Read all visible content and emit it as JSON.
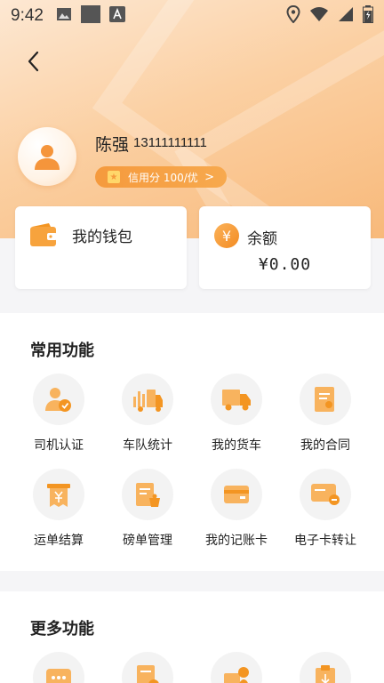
{
  "status_bar": {
    "time": "9:42"
  },
  "profile": {
    "name": "陈强",
    "phone": "13111111111",
    "credit_label": "信用分 100/优"
  },
  "wallet": {
    "label": "我的钱包"
  },
  "balance": {
    "label": "余额",
    "amount": "¥0.00",
    "currency_symbol": "¥"
  },
  "common_section": {
    "title": "常用功能",
    "items": [
      {
        "label": "司机认证",
        "icon": "driver-certification-icon"
      },
      {
        "label": "车队统计",
        "icon": "fleet-statistics-icon"
      },
      {
        "label": "我的货车",
        "icon": "truck-icon"
      },
      {
        "label": "我的合同",
        "icon": "contract-icon"
      },
      {
        "label": "运单结算",
        "icon": "waybill-settlement-icon"
      },
      {
        "label": "磅单管理",
        "icon": "weighbill-management-icon"
      },
      {
        "label": "我的记账卡",
        "icon": "account-card-icon"
      },
      {
        "label": "电子卡转让",
        "icon": "ecard-transfer-icon"
      }
    ]
  },
  "more_section": {
    "title": "更多功能",
    "items": [
      {
        "icon": "chat-icon"
      },
      {
        "icon": "document-icon"
      },
      {
        "icon": "service-icon"
      },
      {
        "icon": "clipboard-icon"
      }
    ]
  },
  "colors": {
    "accent": "#F59A3D",
    "hero_light": "#FDE8D3",
    "hero_dark": "#F8B97A"
  }
}
